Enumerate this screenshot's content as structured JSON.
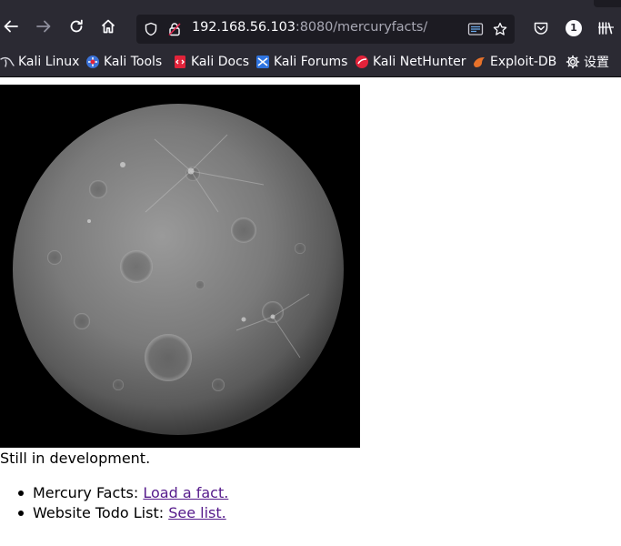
{
  "browser": {
    "url_host": "192.168.56.103",
    "url_path": ":8080/mercuryfacts/",
    "notification_count": "1"
  },
  "bookmarks": [
    {
      "label": "Kali Linux",
      "icon": "kali-dragon-icon"
    },
    {
      "label": "Kali Tools",
      "icon": "kali-tools-icon"
    },
    {
      "label": "Kali Docs",
      "icon": "kali-docs-icon"
    },
    {
      "label": "Kali Forums",
      "icon": "kali-forums-icon"
    },
    {
      "label": "Kali NetHunter",
      "icon": "kali-nethunter-icon"
    },
    {
      "label": "Exploit-DB",
      "icon": "exploit-db-icon"
    },
    {
      "label": "设置",
      "icon": "gear-icon"
    }
  ],
  "page": {
    "status_text": "Still in development.",
    "items": [
      {
        "prefix": "Mercury Facts: ",
        "link": "Load a fact."
      },
      {
        "prefix": "Website Todo List: ",
        "link": "See list."
      }
    ]
  },
  "colors": {
    "chrome_bg": "#2b2a33",
    "urlbar_bg": "#1c1b22",
    "link_visited": "#551a8b"
  }
}
